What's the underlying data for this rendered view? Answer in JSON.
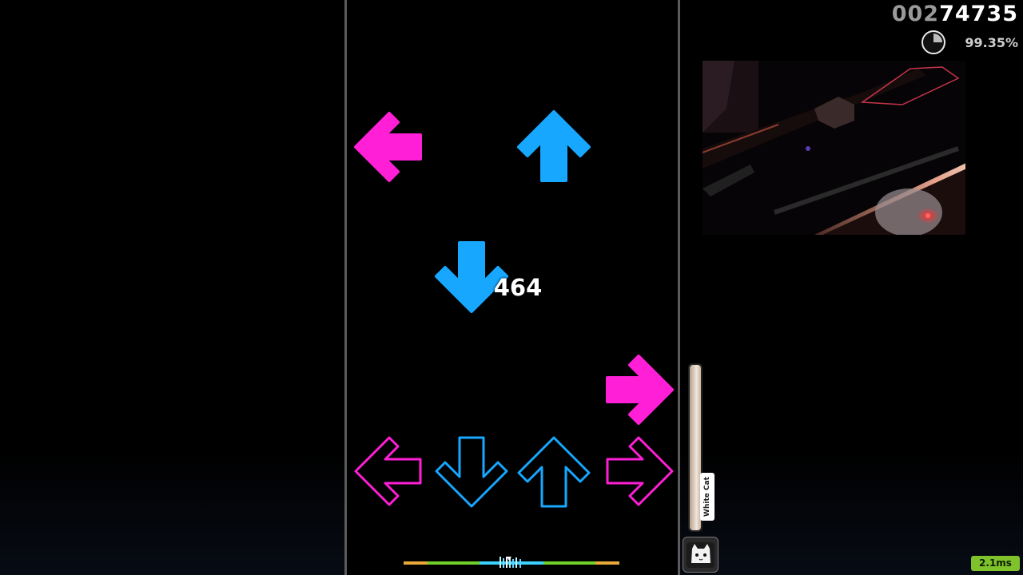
{
  "hud": {
    "score_dim": "002",
    "score_main": "74735",
    "accuracy": "99.35%",
    "combo": "464",
    "latency": "2.1ms",
    "player_name": "White Cat"
  },
  "colors": {
    "pink": "#ff1fd6",
    "blue": "#17a7ff",
    "border": "#5b5b5b",
    "latency_badge": "#7fc22b"
  },
  "lanes": [
    {
      "direction": "left",
      "color": "pink",
      "icon": "left-arrow-icon"
    },
    {
      "direction": "down",
      "color": "blue",
      "icon": "down-arrow-icon"
    },
    {
      "direction": "up",
      "color": "blue",
      "icon": "up-arrow-icon"
    },
    {
      "direction": "right",
      "color": "pink",
      "icon": "right-arrow-icon"
    }
  ]
}
